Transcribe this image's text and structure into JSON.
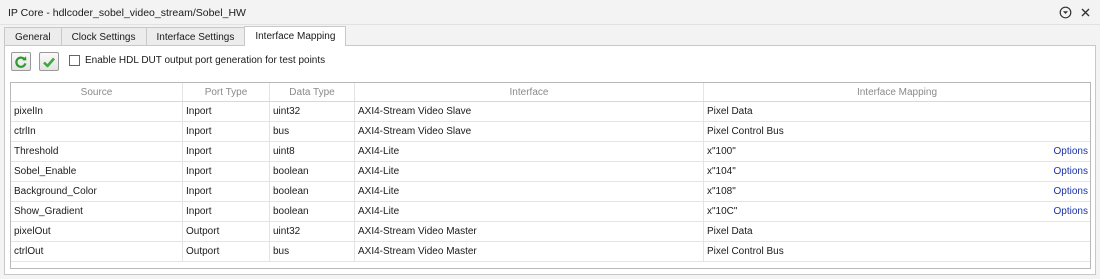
{
  "window": {
    "title": "IP Core - hdlcoder_sobel_video_stream/Sobel_HW",
    "icons": [
      "expand-circle-icon",
      "close-icon"
    ]
  },
  "tabs": [
    {
      "label": "General",
      "active": false
    },
    {
      "label": "Clock Settings",
      "active": false
    },
    {
      "label": "Interface Settings",
      "active": false
    },
    {
      "label": "Interface Mapping",
      "active": true
    }
  ],
  "toolbar": {
    "refresh_icon": "refresh-icon",
    "validate_icon": "checkmark-icon",
    "checkbox_label": "Enable HDL DUT output port generation for test points",
    "checkbox_checked": false
  },
  "table": {
    "columns": [
      "Source",
      "Port Type",
      "Data Type",
      "Interface",
      "Interface Mapping"
    ],
    "rows": [
      {
        "source": "pixelIn",
        "port_type": "Inport",
        "data_type": "uint32",
        "interface": "AXI4-Stream Video Slave",
        "mapping": "Pixel Data",
        "options": ""
      },
      {
        "source": "ctrlIn",
        "port_type": "Inport",
        "data_type": "bus",
        "interface": "AXI4-Stream Video Slave",
        "mapping": "Pixel Control Bus",
        "options": ""
      },
      {
        "source": "Threshold",
        "port_type": "Inport",
        "data_type": "uint8",
        "interface": "AXI4-Lite",
        "mapping": "x\"100\"",
        "options": "Options"
      },
      {
        "source": "Sobel_Enable",
        "port_type": "Inport",
        "data_type": "boolean",
        "interface": "AXI4-Lite",
        "mapping": "x\"104\"",
        "options": "Options"
      },
      {
        "source": "Background_Color",
        "port_type": "Inport",
        "data_type": "boolean",
        "interface": "AXI4-Lite",
        "mapping": "x\"108\"",
        "options": "Options"
      },
      {
        "source": "Show_Gradient",
        "port_type": "Inport",
        "data_type": "boolean",
        "interface": "AXI4-Lite",
        "mapping": "x\"10C\"",
        "options": "Options"
      },
      {
        "source": "pixelOut",
        "port_type": "Outport",
        "data_type": "uint32",
        "interface": "AXI4-Stream Video Master",
        "mapping": "Pixel Data",
        "options": ""
      },
      {
        "source": "ctrlOut",
        "port_type": "Outport",
        "data_type": "bus",
        "interface": "AXI4-Stream Video Master",
        "mapping": "Pixel Control Bus",
        "options": ""
      }
    ]
  },
  "colors": {
    "link": "#1a33a8",
    "refresh_green": "#2e9a2e",
    "check_green": "#3fa83f"
  }
}
